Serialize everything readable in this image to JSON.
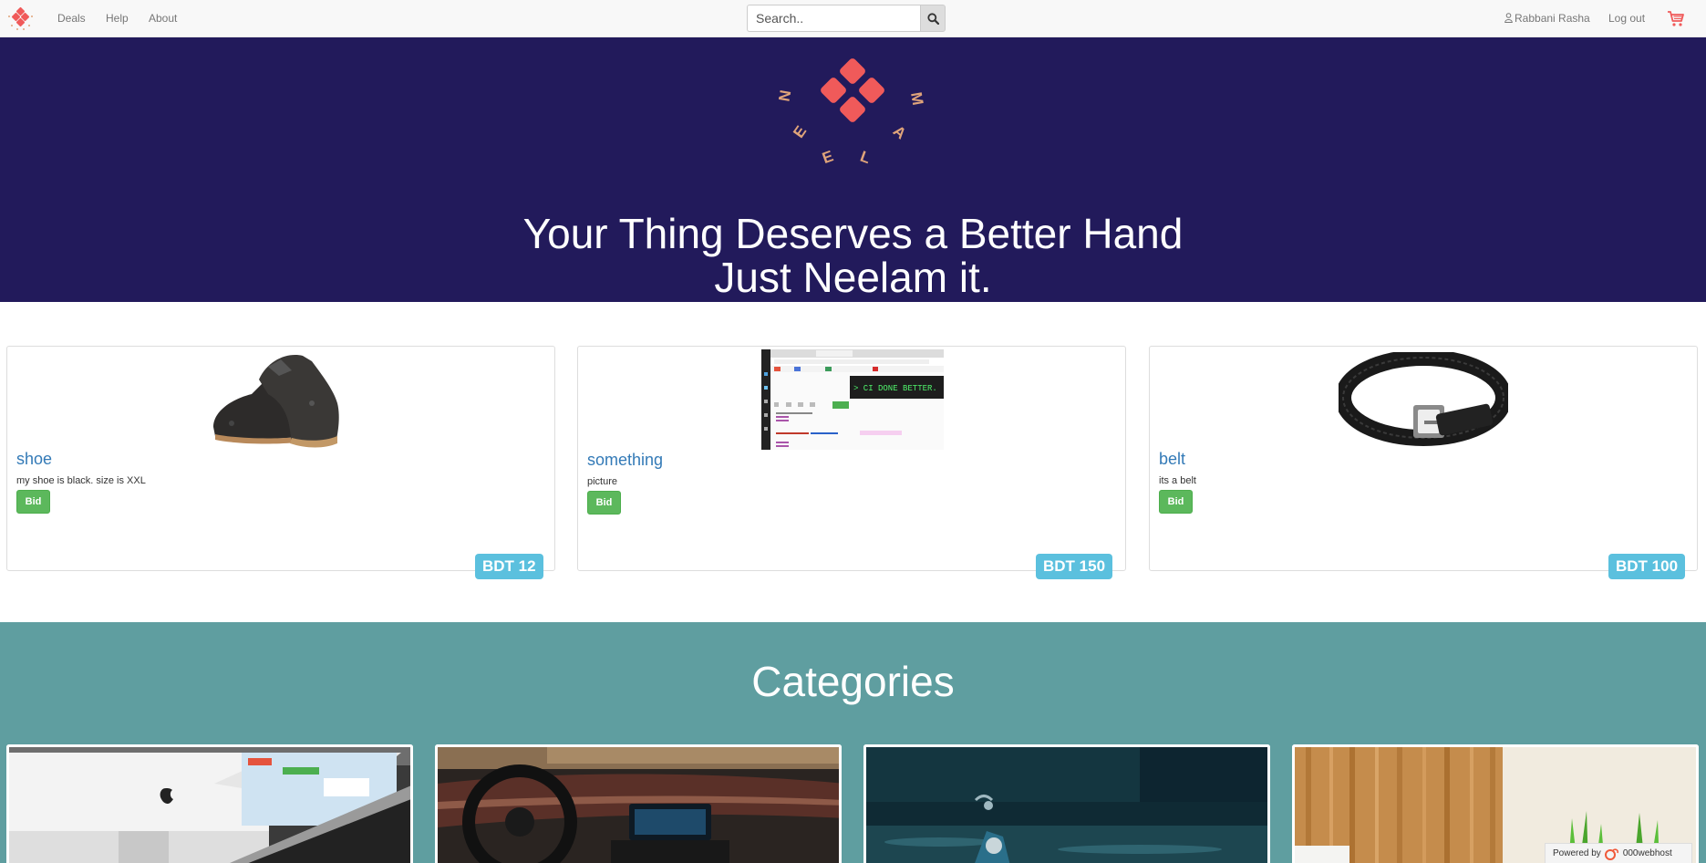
{
  "nav": {
    "links": [
      "Deals",
      "Help",
      "About"
    ],
    "search_placeholder": "Search..",
    "user_name": "Rabbani Rasha",
    "logout": "Log out"
  },
  "hero": {
    "logo_letters": [
      "N",
      "E",
      "E",
      "L",
      "A",
      "M"
    ],
    "headline_line1": "Your Thing Deserves a Better Hand",
    "headline_line2": "Just Neelam it."
  },
  "products": [
    {
      "title": "shoe",
      "description": "my shoe is black. size is XXL",
      "bid_label": "Bid",
      "price": "BDT 12"
    },
    {
      "title": "something",
      "description": "picture",
      "bid_label": "Bid",
      "price": "BDT 150"
    },
    {
      "title": "belt",
      "description": "its a belt",
      "bid_label": "Bid",
      "price": "BDT 100"
    }
  ],
  "screenshot_text": {
    "terminal": "> CI DONE BETTER."
  },
  "categories": {
    "title": "Categories"
  },
  "footer": {
    "powered_by": "Powered by",
    "host": "000webhost"
  },
  "colors": {
    "accent": "#f05a5a",
    "hero_bg": "#221a5b",
    "categories_bg": "#5f9ea0",
    "link": "#337ab7",
    "bid_green": "#5cb85c",
    "price_badge": "#5bc0de"
  }
}
